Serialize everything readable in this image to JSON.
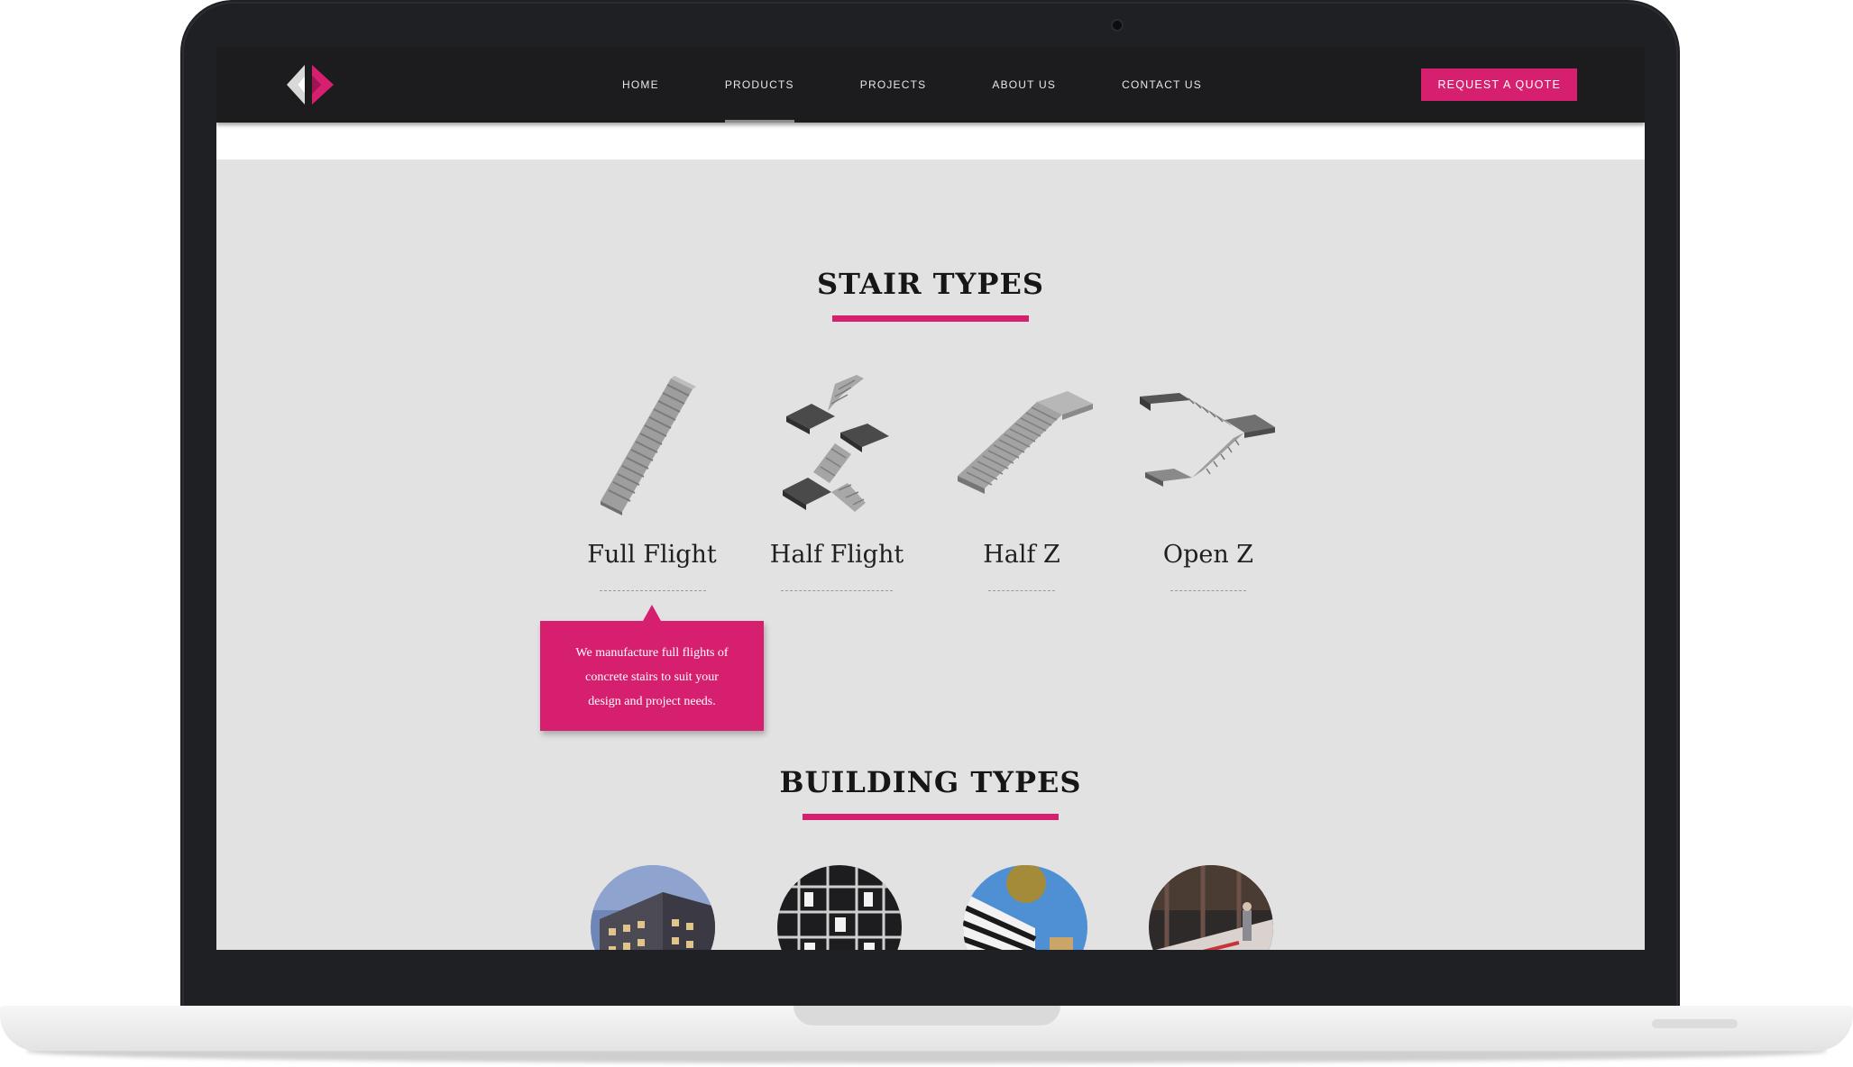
{
  "nav": {
    "logo_name": "brand-logo",
    "links": [
      {
        "label": "HOME",
        "active": false
      },
      {
        "label": "PRODUCTS",
        "active": true
      },
      {
        "label": "PROJECTS",
        "active": false
      },
      {
        "label": "ABOUT US",
        "active": false
      },
      {
        "label": "CONTACT US",
        "active": false
      }
    ],
    "cta_label": "REQUEST A QUOTE"
  },
  "stair_section": {
    "title": "STAIR TYPES",
    "items": [
      {
        "label": "Full Flight",
        "icon": "full-flight-stair-icon"
      },
      {
        "label": "Half Flight",
        "icon": "half-flight-stair-icon"
      },
      {
        "label": "Half Z",
        "icon": "half-z-stair-icon"
      },
      {
        "label": "Open Z",
        "icon": "open-z-stair-icon"
      }
    ],
    "tooltip_lines": [
      "We manufacture full flights of",
      "concrete stairs to suit your",
      "design and project needs."
    ]
  },
  "building_section": {
    "title": "BUILDING TYPES",
    "images": [
      "apartment-building-photo",
      "building-frame-photo",
      "car-park-photo",
      "construction-site-photo"
    ]
  },
  "colors": {
    "accent": "#d6206f",
    "navbar": "#1c1c1e",
    "page_bg": "#e2e2e3",
    "bezel": "#1f2024"
  }
}
